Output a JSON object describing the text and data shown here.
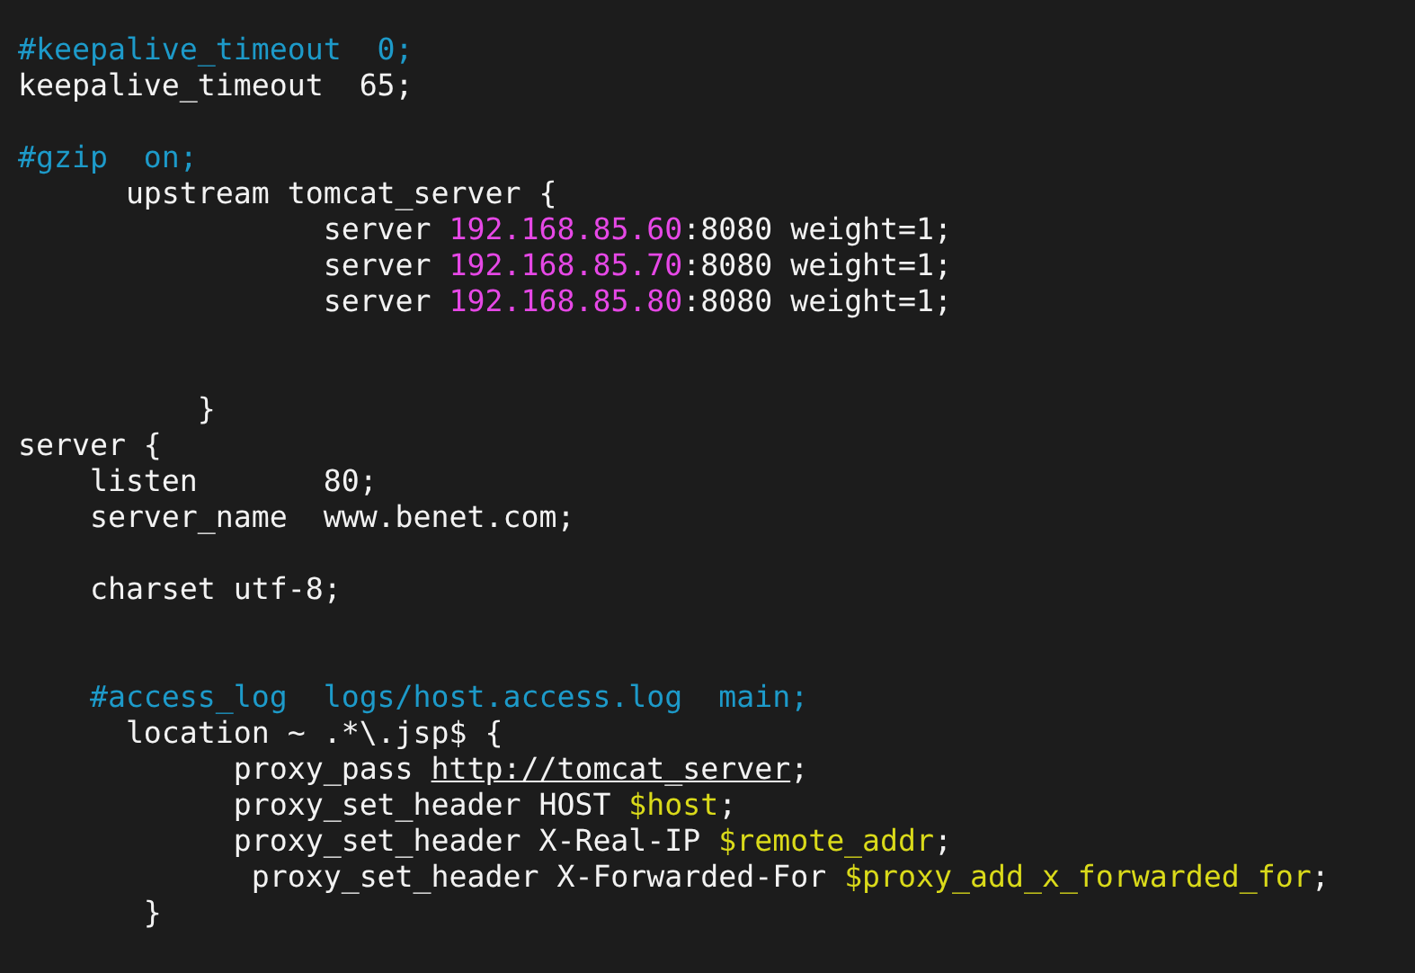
{
  "terminal": {
    "lines": [
      {
        "kind": "code",
        "segments": [
          {
            "kind": "comment",
            "text": "#keepalive_timeout  0;"
          }
        ]
      },
      {
        "kind": "code",
        "segments": [
          {
            "kind": "plain",
            "text": "keepalive_timeout  65;"
          }
        ]
      },
      {
        "kind": "blank"
      },
      {
        "kind": "code",
        "segments": [
          {
            "kind": "comment",
            "text": "#gzip  on;"
          }
        ]
      },
      {
        "kind": "code",
        "segments": [
          {
            "kind": "plain",
            "text": "      upstream tomcat_server {"
          }
        ]
      },
      {
        "kind": "code",
        "segments": [
          {
            "kind": "plain",
            "text": "                 server "
          },
          {
            "kind": "ip",
            "text": "192.168.85.60"
          },
          {
            "kind": "plain",
            "text": ":8080 weight=1;"
          }
        ]
      },
      {
        "kind": "code",
        "segments": [
          {
            "kind": "plain",
            "text": "                 server "
          },
          {
            "kind": "ip",
            "text": "192.168.85.70"
          },
          {
            "kind": "plain",
            "text": ":8080 weight=1;"
          }
        ]
      },
      {
        "kind": "code",
        "segments": [
          {
            "kind": "plain",
            "text": "                 server "
          },
          {
            "kind": "ip",
            "text": "192.168.85.80"
          },
          {
            "kind": "plain",
            "text": ":8080 weight=1;"
          }
        ]
      },
      {
        "kind": "blank"
      },
      {
        "kind": "blank"
      },
      {
        "kind": "code",
        "segments": [
          {
            "kind": "plain",
            "text": "          }"
          }
        ]
      },
      {
        "kind": "code",
        "segments": [
          {
            "kind": "plain",
            "text": "server {"
          }
        ]
      },
      {
        "kind": "code",
        "segments": [
          {
            "kind": "plain",
            "text": "    listen       80;"
          }
        ]
      },
      {
        "kind": "code",
        "segments": [
          {
            "kind": "plain",
            "text": "    server_name  www.benet.com;"
          }
        ]
      },
      {
        "kind": "blank"
      },
      {
        "kind": "code",
        "segments": [
          {
            "kind": "plain",
            "text": "    charset utf-8;"
          }
        ]
      },
      {
        "kind": "blank"
      },
      {
        "kind": "blank"
      },
      {
        "kind": "code",
        "segments": [
          {
            "kind": "comment",
            "text": "    #access_log  logs/host.access.log  main;"
          }
        ]
      },
      {
        "kind": "code",
        "segments": [
          {
            "kind": "plain",
            "text": "      location ~ .*\\.jsp$ {"
          }
        ]
      },
      {
        "kind": "code",
        "segments": [
          {
            "kind": "plain",
            "text": "            proxy_pass "
          },
          {
            "kind": "link",
            "text": "http://tomcat_server"
          },
          {
            "kind": "plain",
            "text": ";"
          }
        ]
      },
      {
        "kind": "code",
        "segments": [
          {
            "kind": "plain",
            "text": "            proxy_set_header HOST "
          },
          {
            "kind": "variable",
            "text": "$host"
          },
          {
            "kind": "plain",
            "text": ";"
          }
        ]
      },
      {
        "kind": "code",
        "segments": [
          {
            "kind": "plain",
            "text": "            proxy_set_header X-Real-IP "
          },
          {
            "kind": "variable",
            "text": "$remote_addr"
          },
          {
            "kind": "plain",
            "text": ";"
          }
        ]
      },
      {
        "kind": "code",
        "segments": [
          {
            "kind": "plain",
            "text": "             proxy_set_header X-Forwarded-For "
          },
          {
            "kind": "variable",
            "text": "$proxy_add_x_forwarded_for"
          },
          {
            "kind": "plain",
            "text": ";"
          }
        ]
      },
      {
        "kind": "code",
        "segments": [
          {
            "kind": "plain",
            "text": "       }"
          }
        ]
      }
    ]
  }
}
